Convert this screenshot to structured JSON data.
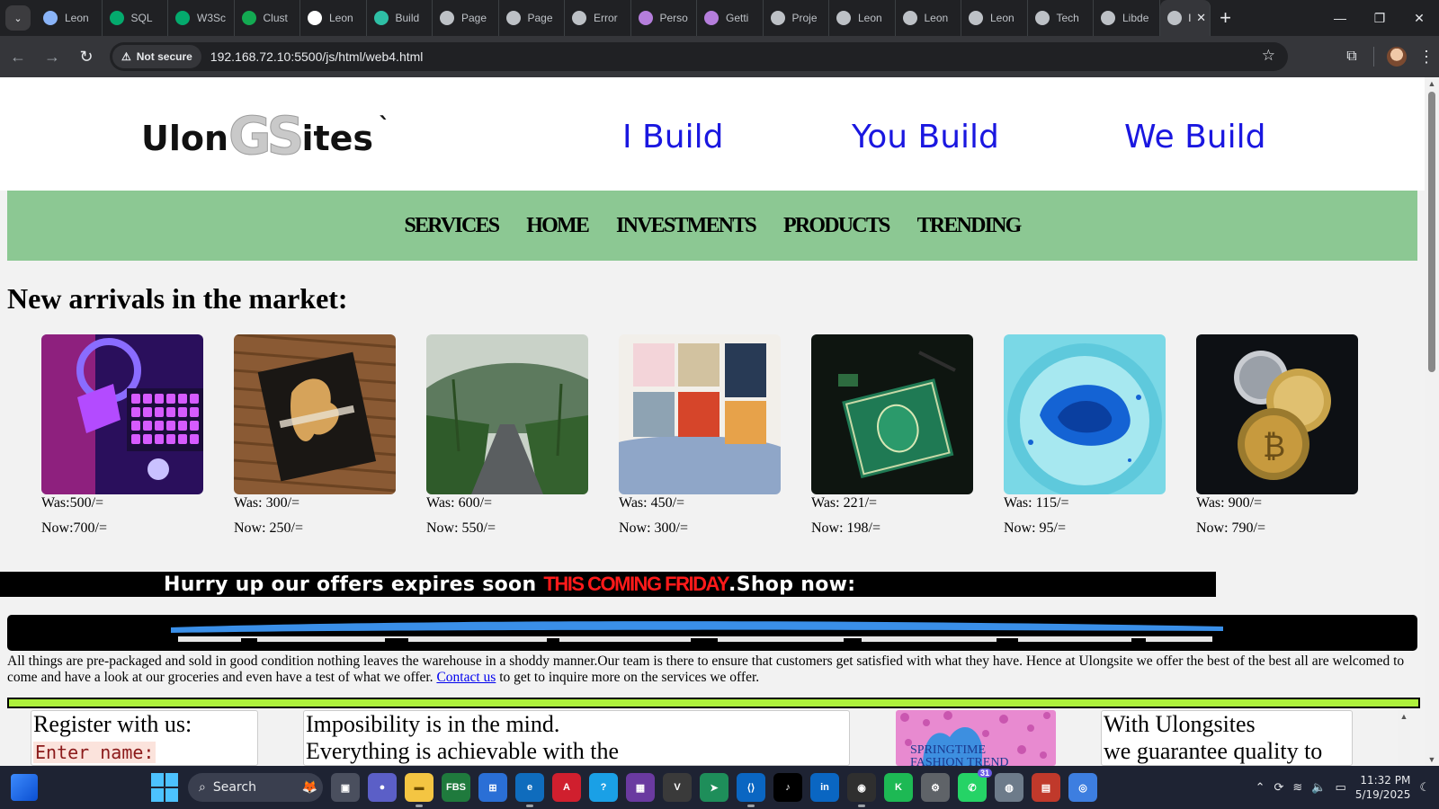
{
  "browser": {
    "tabs": [
      {
        "title": "Leon",
        "icon": "gear-flower-icon",
        "color": "#8ab4f8"
      },
      {
        "title": "SQL",
        "icon": "w3schools-icon",
        "color": "#04aa6d"
      },
      {
        "title": "W3Sc",
        "icon": "w3schools-icon",
        "color": "#04aa6d"
      },
      {
        "title": "Clust",
        "icon": "mongodb-leaf-icon",
        "color": "#13aa52"
      },
      {
        "title": "Leon",
        "icon": "github-icon",
        "color": "#ffffff"
      },
      {
        "title": "Build",
        "icon": "diamond-icon",
        "color": "#2ebfa5"
      },
      {
        "title": "Page",
        "icon": "globe-icon",
        "color": "#bdc1c6"
      },
      {
        "title": "Page",
        "icon": "globe-icon",
        "color": "#bdc1c6"
      },
      {
        "title": "Error",
        "icon": "globe-icon",
        "color": "#bdc1c6"
      },
      {
        "title": "Perso",
        "icon": "hashnode-icon",
        "color": "#b57edc"
      },
      {
        "title": "Getti",
        "icon": "hashnode-icon",
        "color": "#b57edc"
      },
      {
        "title": "Proje",
        "icon": "globe-icon",
        "color": "#bdc1c6"
      },
      {
        "title": "Leon",
        "icon": "globe-icon",
        "color": "#bdc1c6"
      },
      {
        "title": "Leon",
        "icon": "globe-icon",
        "color": "#bdc1c6"
      },
      {
        "title": "Leon",
        "icon": "globe-icon",
        "color": "#bdc1c6"
      },
      {
        "title": "Tech",
        "icon": "globe-icon",
        "color": "#bdc1c6"
      },
      {
        "title": "Libde",
        "icon": "globe-icon",
        "color": "#bdc1c6"
      }
    ],
    "active_tab": {
      "title": "l",
      "icon": "globe-icon"
    },
    "security_label": "Not secure",
    "url": "192.168.72.10:5500/js/html/web4.html"
  },
  "site": {
    "logo": {
      "pre": "Ulon",
      "mark": "GS",
      "post": "ites",
      "tail": "`"
    },
    "taglines": [
      "I Build",
      "You Build",
      "We Build"
    ],
    "nav": [
      "SERVICES",
      "HOME",
      "INVESTMENTS",
      "PRODUCTS",
      "TRENDING"
    ],
    "section_title": "New arrivals in the market:",
    "products": [
      {
        "image": "gaming-desk-photo",
        "was": "Was:500/=",
        "now": "Now:700/="
      },
      {
        "image": "sculpture-book-photo",
        "was": "Was: 300/=",
        "now": "Now: 250/="
      },
      {
        "image": "palm-road-photo",
        "was": "Was: 600/=",
        "now": "Now: 550/="
      },
      {
        "image": "books-collection-photo",
        "was": "Was: 450/=",
        "now": "Now: 300/="
      },
      {
        "image": "green-book-photo",
        "was": "Was: 221/=",
        "now": "Now: 198/="
      },
      {
        "image": "blue-ink-photo",
        "was": "Was: 115/=",
        "now": "Now: 95/="
      },
      {
        "image": "crypto-coins-photo",
        "was": "Was: 900/=",
        "now": "Now: 790/="
      }
    ],
    "offer": {
      "lead": "Hurry up our offers expires soon ",
      "highlight": "THIS COMING FRIDAY",
      "tail": ".Shop now:"
    },
    "about_text": "All things are pre-packaged and sold in good condition nothing leaves the warehouse in a shoddy manner.Our team is there to ensure that customers get satisfied with what they have. Hence at Ulongsite we offer the best of the best all are welcomed to come and have a look at our groceries and even have a test of what we offer. ",
    "contact_link": "Contact us",
    "about_tail": " to get to inquire more on the services we offer.",
    "register": {
      "title": "Register with us:",
      "name_label": "Enter name:"
    },
    "quote": {
      "line1": "Imposibility is in the mind.",
      "line2": "Everything is achievable with the"
    },
    "promo_text": "SPRINGTIME FASHION TREND",
    "guarantee": {
      "line1": "With Ulongsites",
      "line2": "we guarantee quality to our"
    }
  },
  "taskbar": {
    "search_label": "Search",
    "whatsapp_badge": "31",
    "time": "11:32 PM",
    "date": "5/19/2025"
  },
  "colors": {
    "nav_bg": "#8cc893",
    "tagline": "#1a17e0",
    "offer_red": "#ff1a1a",
    "rule_green": "#aef13c"
  }
}
